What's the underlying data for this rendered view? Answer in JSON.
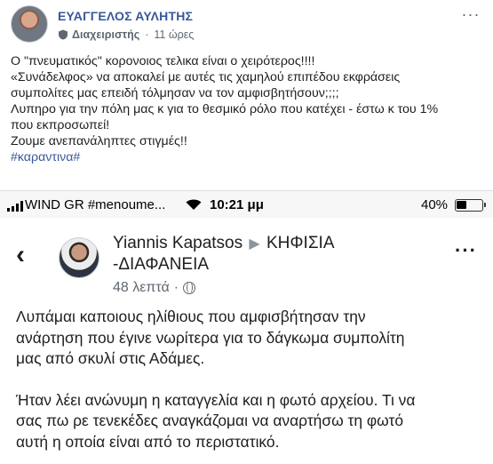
{
  "post": {
    "author": "ΕΥΑΓΓΕΛΟΣ ΑΥΛΗΤΗΣ",
    "role": "Διαχειριστής",
    "separator": "·",
    "time": "11 ώρες",
    "more": "···",
    "lines": [
      "Ο \"πνευματικός\" κορονοιος τελικα είναι ο χειρότερος!!!!",
      "«Συνάδελφος» να αποκαλεί με αυτές τις χαμηλού επιπέδου εκφράσεις",
      "συμπολίτες μας επειδή τόλμησαν να τον αμφισβητήσουν;;;;",
      "Λυπηρο για την πόλη μας κ για το θεσμικό ρόλο που κατέχει - έστω κ του 1%",
      "που εκπροσωπεί!",
      "Ζουμε ανεπανάληπτες στιγμές!!"
    ],
    "hashtag": "#καραντινα#"
  },
  "screenshot": {
    "status": {
      "carrier": "WIND GR #menoume...",
      "time": "10:21 μμ",
      "battery": "40%"
    },
    "back": "‹",
    "name": "Yiannis Kapatsos",
    "arrow": "▶",
    "group_line1": "ΚΗΦΙΣΙΑ",
    "group_line2": "-ΔΙΑΦΑΝΕΙΑ",
    "time": "48 λεπτά",
    "separator": "·",
    "more": "···",
    "paragraph1": [
      "Λυπάμαι καποιους ηλίθιους που αμφισβήτησαν την",
      "ανάρτηση που έγινε νωρίτερα για το δάγκωμα συμπολίτη",
      "μας από σκυλί στις Αδάμες."
    ],
    "paragraph2": [
      "Ήταν λέει ανώνυμη η καταγγελία και η φωτό αρχείου. Τι να",
      "σας πω ρε τενεκέδες αναγκάζομαι να αναρτήσω τη φωτό",
      "αυτή η οποία είναι από το περιστατικό."
    ]
  }
}
